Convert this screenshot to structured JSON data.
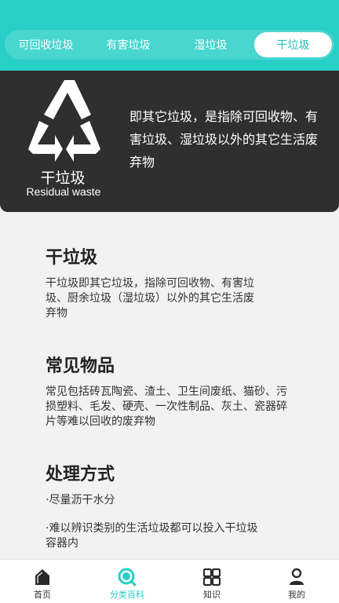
{
  "tabs": [
    {
      "label": "可回收垃圾",
      "active": false
    },
    {
      "label": "有害垃圾",
      "active": false
    },
    {
      "label": "湿垃圾",
      "active": false
    },
    {
      "label": "干垃圾",
      "active": true
    }
  ],
  "hero": {
    "logo_icon": "recycle-triangle-icon",
    "name_cn": "干垃圾",
    "name_en": "Residual waste",
    "description": "即其它垃圾，是指除可回收物、有害垃圾、湿垃圾以外的其它生活废弃物"
  },
  "sections": [
    {
      "title": "干垃圾",
      "text": "干垃圾即其它垃圾，指除可回收物、有害垃圾、厨余垃圾（湿垃圾）以外的其它生活废弃物"
    },
    {
      "title": "常见物品",
      "text": "常见包括砖瓦陶瓷、渣土、卫生间废纸、猫砂、污损塑料、毛发、硬壳、一次性制品、灰土、瓷器碎片等难以回收的废弃物"
    },
    {
      "title": "处理方式",
      "items": [
        "·尽量沥干水分",
        "·难以辨识类别的生活垃圾都可以投入干垃圾容器内"
      ]
    }
  ],
  "bottom_nav": [
    {
      "label": "首页",
      "icon": "home-icon",
      "active": false
    },
    {
      "label": "分类百科",
      "icon": "search-icon",
      "active": true
    },
    {
      "label": "知识",
      "icon": "grid-icon",
      "active": false
    },
    {
      "label": "我的",
      "icon": "user-icon",
      "active": false
    }
  ],
  "colors": {
    "accent": "#27cfc6",
    "hero_bg": "#2f2f2f",
    "page_bg": "#f2f2f2"
  }
}
